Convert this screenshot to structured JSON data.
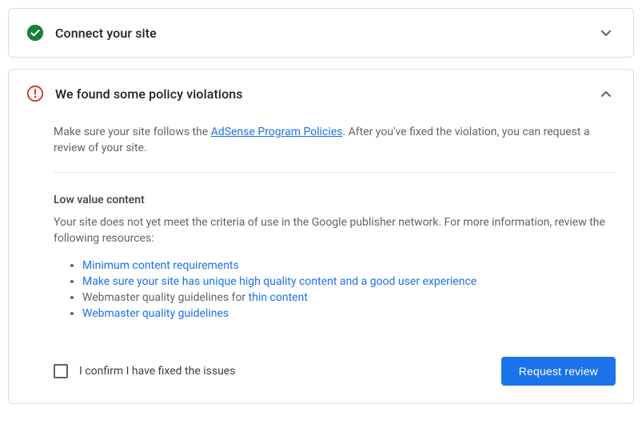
{
  "cards": {
    "connect": {
      "title": "Connect your site"
    },
    "violations": {
      "title": "We found some policy violations",
      "intro_before": "Make sure your site follows the ",
      "intro_link": "AdSense Program Policies",
      "intro_after": ". After you've fixed the violation, you can request a review of your site.",
      "section_title": "Low value content",
      "section_text": "Your site does not yet meet the criteria of use in the Google publisher network. For more information, review the following resources:",
      "bullets": {
        "b1": "Minimum content requirements",
        "b2": "Make sure your site has unique high quality content and a good user experience",
        "b3_before": "Webmaster quality guidelines for ",
        "b3_link": "thin content",
        "b4": "Webmaster quality guidelines"
      },
      "confirm_label": "I confirm I have fixed the issues",
      "request_button": "Request review"
    }
  }
}
